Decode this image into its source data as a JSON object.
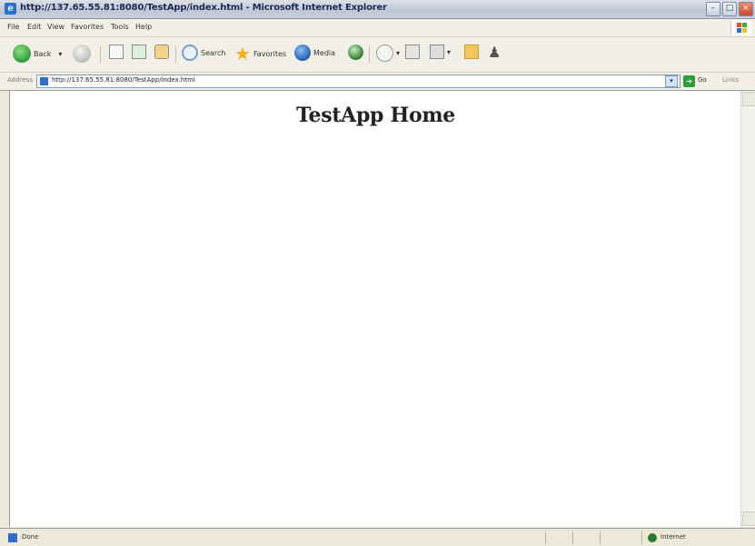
{
  "window": {
    "title": "http://137.65.55.81:8080/TestApp/index.html - Microsoft Internet Explorer"
  },
  "menu": {
    "items": [
      "File",
      "Edit",
      "View",
      "Favorites",
      "Tools",
      "Help"
    ]
  },
  "toolbar": {
    "back_label": "Back",
    "search_label": "Search",
    "favorites_label": "Favorites",
    "media_label": "Media"
  },
  "address": {
    "label": "Address",
    "url": "http://137.65.55.81:8080/TestApp/index.html",
    "go_label": "Go",
    "links_label": "Links"
  },
  "page": {
    "heading": "TestApp Home"
  },
  "status": {
    "text": "Done",
    "zone": "Internet"
  },
  "colors": {
    "chrome": "#ece9d8",
    "content_bg": "#ffffff",
    "heading_text": "#222222"
  }
}
